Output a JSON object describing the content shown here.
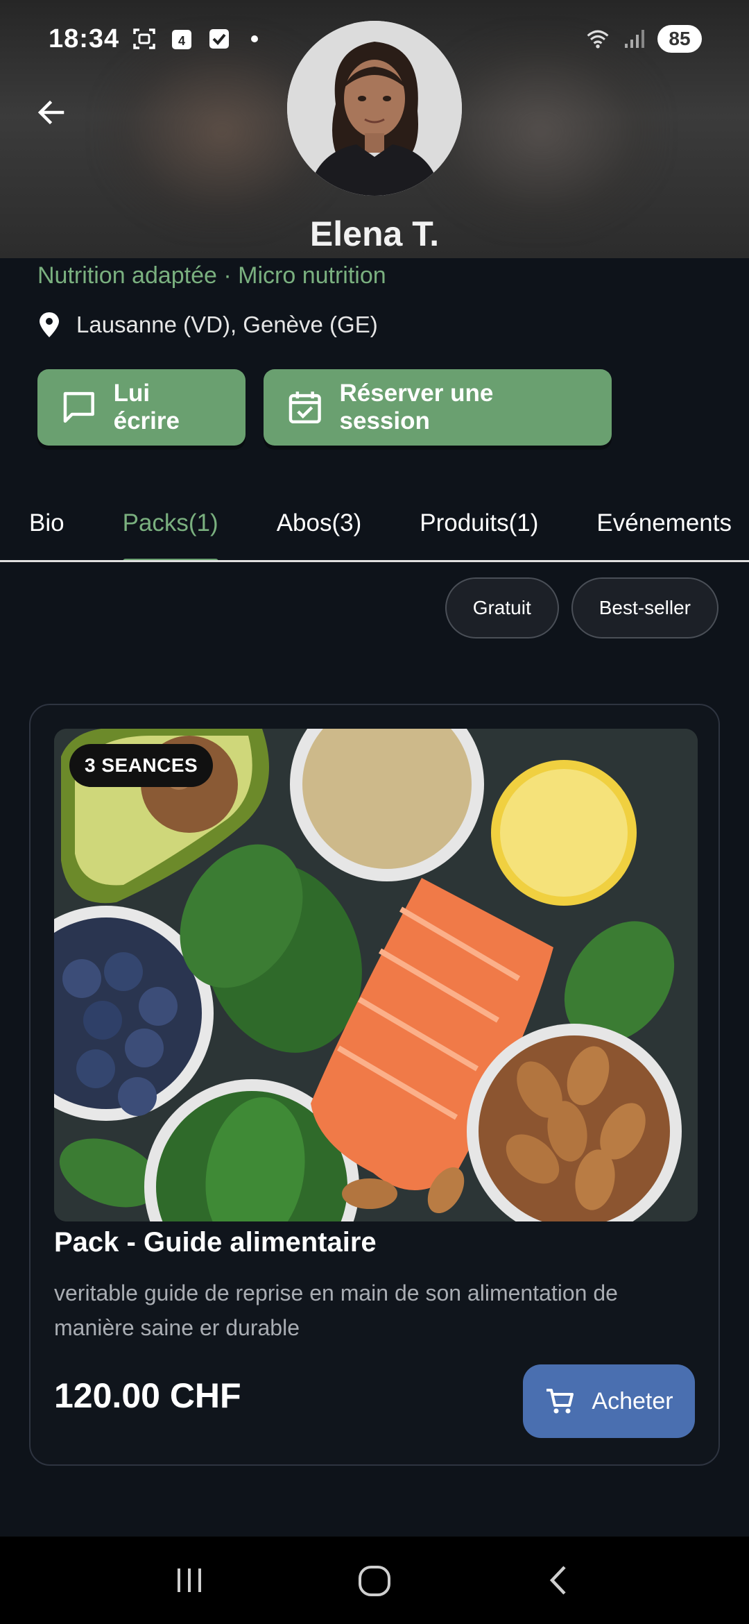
{
  "status_bar": {
    "time": "18:34",
    "calendar_day": "4",
    "battery": "85"
  },
  "profile": {
    "name": "Elena T.",
    "specialties": "Nutrition adaptée · Micro nutrition",
    "location": "Lausanne (VD), Genève (GE)"
  },
  "actions": {
    "write_label": "Lui écrire",
    "book_label": "Réserver une session"
  },
  "tabs": [
    {
      "label": "Bio",
      "active": false
    },
    {
      "label": "Packs(1)",
      "active": true
    },
    {
      "label": "Abos(3)",
      "active": false
    },
    {
      "label": "Produits(1)",
      "active": false
    },
    {
      "label": "Evénements",
      "active": false
    }
  ],
  "filters": {
    "free_label": "Gratuit",
    "bestseller_label": "Best-seller"
  },
  "pack": {
    "badge": "3 SEANCES",
    "title": "Pack - Guide alimentaire",
    "description": "veritable guide de reprise en main de son alimentation de manière saine er durable",
    "price": "120.00 CHF",
    "buy_label": "Acheter"
  },
  "colors": {
    "accent_green": "#6aa070",
    "accent_blue": "#4a6fb0",
    "background": "#0e131a"
  },
  "icons": {
    "back": "arrow-left-icon",
    "location": "map-pin-icon",
    "write": "chat-bubble-icon",
    "book": "calendar-check-icon",
    "buy": "cart-icon"
  }
}
